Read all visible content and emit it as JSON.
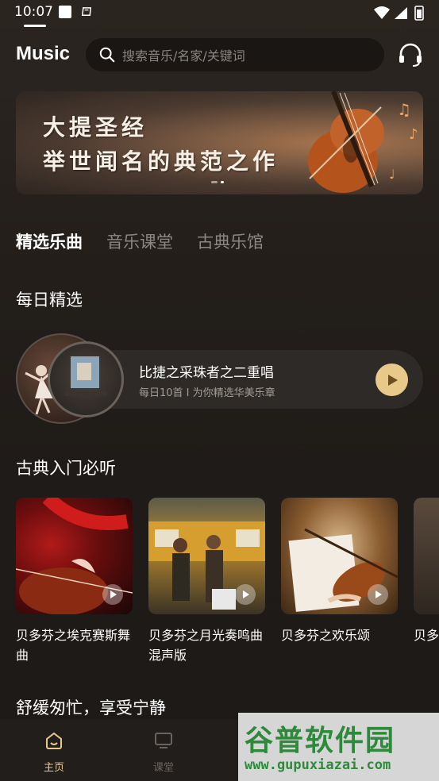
{
  "status": {
    "time": "10:07"
  },
  "header": {
    "brand": "Music",
    "search_placeholder": "搜索音乐/名家/关键词"
  },
  "banner": {
    "line1": "大提圣经",
    "line2": "举世闻名的典范之作"
  },
  "tabs": [
    {
      "label": "精选乐曲",
      "active": true
    },
    {
      "label": "音乐课堂",
      "active": false
    },
    {
      "label": "古典乐馆",
      "active": false
    }
  ],
  "daily": {
    "section_title": "每日精选",
    "title": "比捷之采珠者之二重唱",
    "subtitle": "每日10首 I 为你精选华美乐章"
  },
  "classics": {
    "section_title": "古典入门必听",
    "cards": [
      {
        "label": "贝多芬之埃克赛斯舞曲"
      },
      {
        "label": "贝多芬之月光奏鸣曲混声版"
      },
      {
        "label": "贝多芬之欢乐颂"
      },
      {
        "label": "贝多芬之乐第"
      }
    ]
  },
  "relax": {
    "section_title": "舒缓匆忙，享受宁静"
  },
  "nav": {
    "items": [
      {
        "label": "主页",
        "icon": "home-icon",
        "active": true
      },
      {
        "label": "课堂",
        "icon": "classroom-icon",
        "active": false
      }
    ]
  },
  "watermark": {
    "big": "谷普软件园",
    "small": "www.gupuxiazai.com"
  },
  "colors": {
    "accent": "#e8c98a",
    "active_nav": "#e8c98a",
    "background": "#231e1b"
  }
}
